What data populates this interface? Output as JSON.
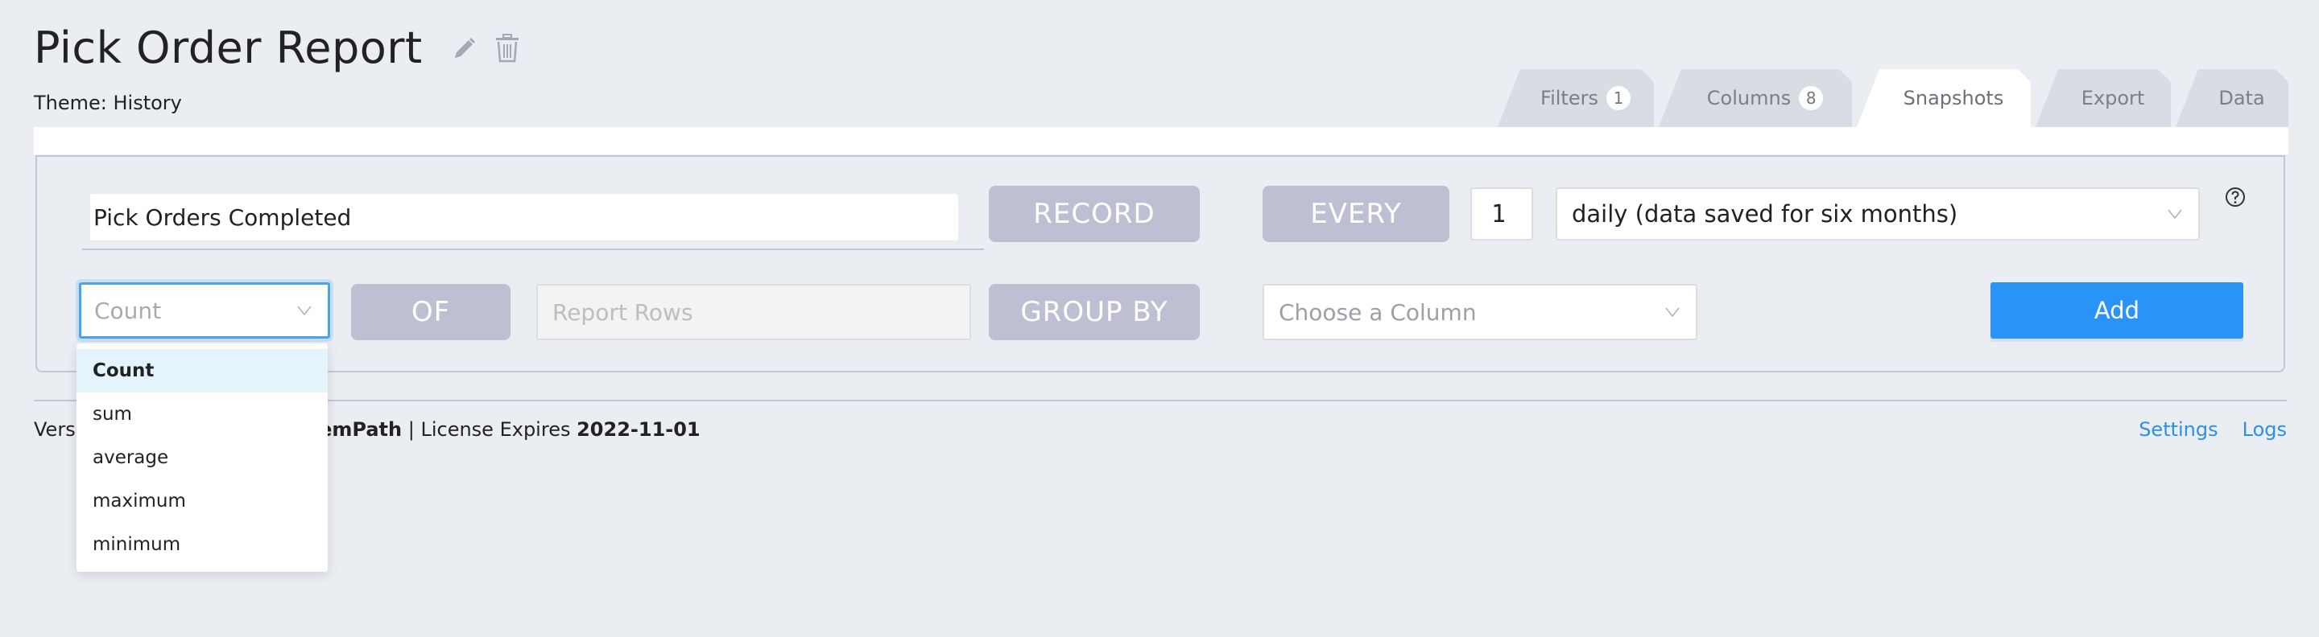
{
  "header": {
    "title": "Pick Order Report",
    "theme_label": "Theme: History",
    "icons": {
      "edit": "pencil-icon",
      "delete": "trash-icon"
    }
  },
  "tabs": [
    {
      "label": "Filters",
      "badge": "1",
      "active": false
    },
    {
      "label": "Columns",
      "badge": "8",
      "active": false
    },
    {
      "label": "Snapshots",
      "badge": null,
      "active": true
    },
    {
      "label": "Export",
      "badge": null,
      "active": false
    },
    {
      "label": "Data",
      "badge": null,
      "active": false
    }
  ],
  "snapshot_form": {
    "name_value": "Pick Orders Completed",
    "record_label": "RECORD",
    "every_label": "EVERY",
    "every_value": "1",
    "interval_value": "daily (data saved for six months)",
    "aggregation_value": "Count",
    "of_label": "OF",
    "of_field_placeholder": "Report Rows",
    "group_by_label": "GROUP BY",
    "group_by_placeholder": "Choose a Column",
    "add_label": "Add",
    "help_icon": "question-circle-icon"
  },
  "aggregation_dropdown": {
    "options": [
      "Count",
      "sum",
      "average",
      "maximum",
      "minimum"
    ],
    "selected": "Count"
  },
  "footer": {
    "version_prefix_visible": "Vers",
    "product": "ItemPath",
    "separator": "|",
    "license_label": "License Expires",
    "license_date": "2022-11-01",
    "links": [
      "Settings",
      "Logs"
    ]
  },
  "colors": {
    "background": "#eaedf2",
    "accent_blue": "#2a94f6",
    "link_blue": "#2a90ea",
    "pill_gray": "#bfbfd4",
    "tab_inactive": "#d8dce3"
  }
}
